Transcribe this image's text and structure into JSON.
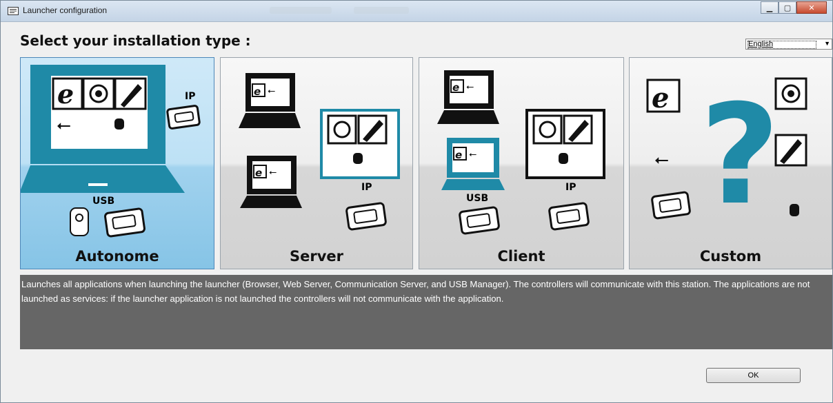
{
  "window": {
    "title": "Launcher configuration"
  },
  "heading": "Select your installation type :",
  "language": {
    "selected": "English"
  },
  "cards": [
    {
      "label": "Autonome",
      "selected": true,
      "badges": {
        "ip": "IP",
        "usb": "USB"
      }
    },
    {
      "label": "Server",
      "selected": false,
      "badges": {
        "ip": "IP"
      }
    },
    {
      "label": "Client",
      "selected": false,
      "badges": {
        "ip": "IP",
        "usb": "USB"
      }
    },
    {
      "label": "Custom",
      "selected": false
    }
  ],
  "description": "Launches all applications when launching the launcher (Browser, Web Server, Communication Server, and USB Manager). The controllers will communicate with this station. The applications are not launched as services: if the launcher application is not launched the controllers will not communicate with the application.",
  "ok_label": "OK",
  "colors": {
    "accent": "#1f8aa7",
    "selected_bg": "#a1d2ee",
    "desc_bg": "#666666"
  },
  "icons": [
    "browser-e-icon",
    "globe-server-icon",
    "usb-plug-icon",
    "usb-symbol-icon",
    "database-icon",
    "ip-controller-icon",
    "usb-reader-icon",
    "question-mark-icon"
  ]
}
